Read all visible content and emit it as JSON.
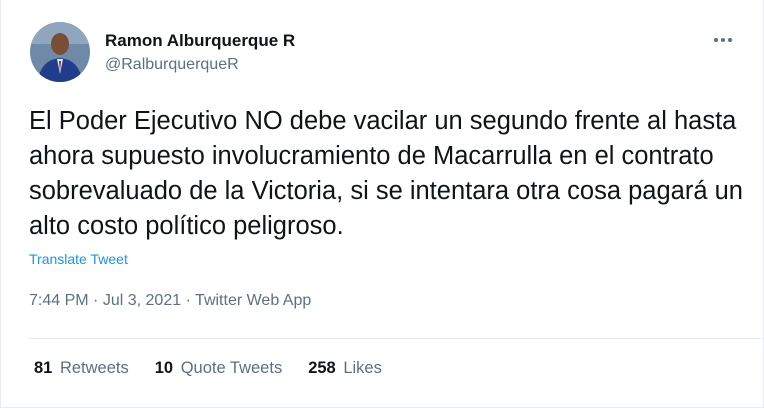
{
  "tweet": {
    "author_name": "Ramon Alburquerque R",
    "author_handle": "@RalburquerqueR",
    "text": "El Poder Ejecutivo NO debe vacilar un segundo frente al hasta ahora supuesto involucramiento de Macarrulla en el contrato sobrevaluado de la Victoria, si se intentara otra cosa pagará un alto costo político peligroso.",
    "translate_label": "Translate Tweet",
    "time": "7:44 PM",
    "date": "Jul 3, 2021",
    "source": "Twitter Web App",
    "separator": "·"
  },
  "stats": {
    "retweets_count": "81",
    "retweets_label": "Retweets",
    "quotes_count": "10",
    "quotes_label": "Quote Tweets",
    "likes_count": "258",
    "likes_label": "Likes"
  },
  "icons": {
    "more": "more-horizontal-icon"
  },
  "colors": {
    "link": "#1b95e0",
    "secondary_text": "#5b7083",
    "primary_text": "#0f1419"
  }
}
